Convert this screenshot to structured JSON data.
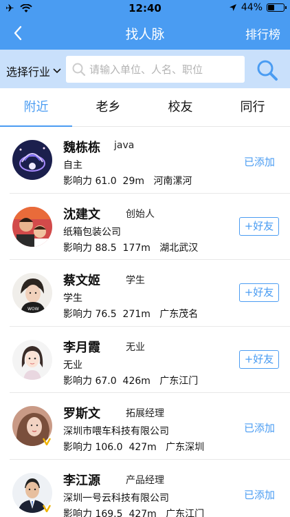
{
  "status_bar": {
    "time": "12:40",
    "battery": "44%",
    "battery_level": 0.44
  },
  "nav": {
    "title": "找人脉",
    "right_label": "排行榜"
  },
  "search": {
    "industry_label": "选择行业",
    "placeholder": "请输入单位、人名、职位"
  },
  "tabs": [
    {
      "label": "附近",
      "active": true
    },
    {
      "label": "老乡",
      "active": false
    },
    {
      "label": "校友",
      "active": false
    },
    {
      "label": "同行",
      "active": false
    }
  ],
  "people": [
    {
      "name": "魏栋栋",
      "role": "java",
      "company": "自主",
      "influence_label": "影响力",
      "influence": "61.0",
      "distance": "29m",
      "location": "河南漯河",
      "action": "已添加",
      "added": true
    },
    {
      "name": "沈建文",
      "role": "创始人",
      "company": "纸箱包装公司",
      "influence_label": "影响力",
      "influence": "88.5",
      "distance": "177m",
      "location": "湖北武汉",
      "action": "+好友",
      "added": false
    },
    {
      "name": "蔡文姬",
      "role": "学生",
      "company": "学生",
      "influence_label": "影响力",
      "influence": "76.5",
      "distance": "271m",
      "location": "广东茂名",
      "action": "+好友",
      "added": false
    },
    {
      "name": "李月霞",
      "role": "无业",
      "company": "无业",
      "influence_label": "影响力",
      "influence": "67.0",
      "distance": "426m",
      "location": "广东江门",
      "action": "+好友",
      "added": false
    },
    {
      "name": "罗斯文",
      "role": "拓展经理",
      "company": "深圳市喂车科技有限公司",
      "influence_label": "影响力",
      "influence": "106.0",
      "distance": "427m",
      "location": "广东深圳",
      "action": "已添加",
      "added": true
    },
    {
      "name": "李江源",
      "role": "产品经理",
      "company": "深圳一号云科技有限公司",
      "influence_label": "影响力",
      "influence": "169.5",
      "distance": "427m",
      "location": "广东江门",
      "action": "已添加",
      "added": true
    }
  ],
  "colors": {
    "accent": "#4a9cf2",
    "search_bg": "#c9e0fb"
  }
}
